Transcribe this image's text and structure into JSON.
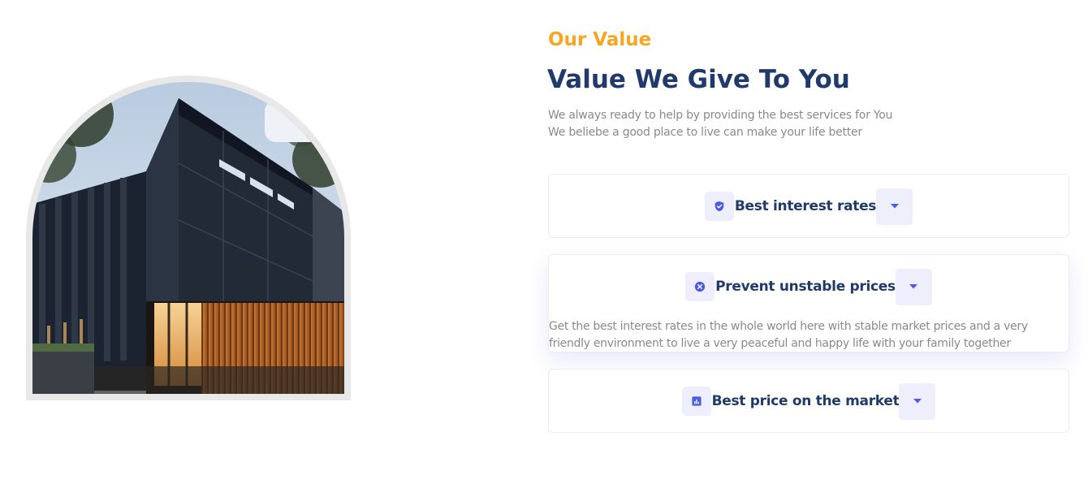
{
  "image": {
    "alt": "Modern dark house with wooden facade"
  },
  "section": {
    "eyebrow": "Our Value",
    "title": "Value We Give To You",
    "lead_line1": "We always ready to help by providing the best services for You",
    "lead_line2": "We beliebe a good place to live can make your life better"
  },
  "accordion": {
    "items": [
      {
        "icon": "shield-check-icon",
        "title": "Best interest rates",
        "expanded": false
      },
      {
        "icon": "x-circle-icon",
        "title": "Prevent unstable prices",
        "expanded": true,
        "body_line1": "Get the best interest rates in the whole world here with stable market prices and a very",
        "body_line2": "friendly environment to live a very peaceful and happy life with your family together"
      },
      {
        "icon": "bar-chart-icon",
        "title": "Best price on the market",
        "expanded": false
      }
    ]
  },
  "colors": {
    "accent": "#f5a623",
    "heading": "#1f3a6b",
    "icon": "#4a5be8",
    "muted_text": "#8a8a8a",
    "chip_bg": "#eeeefc"
  }
}
